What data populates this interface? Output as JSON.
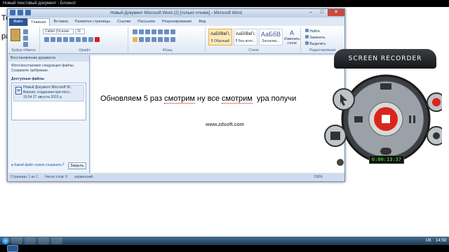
{
  "notepad": {
    "title": "Новый текстовый документ - Блокнот",
    "text_line1": "Те",
    "text_line2": "ра"
  },
  "word": {
    "title": "Новый Документ Microsoft Word (2) [только чтение] - Microsoft Word",
    "tabs": [
      "Файл",
      "Главная",
      "Вставка",
      "Разметка страницы",
      "Ссылки",
      "Рассылки",
      "Рецензирование",
      "Вид"
    ],
    "ribbon": {
      "clipboard_label": "Буфер обмена",
      "font_label": "Шрифт",
      "paragraph_label": "Абзац",
      "styles_label": "Стили",
      "editing_label": "Редактирование",
      "font_name": "Calibri (Основн",
      "font_size": "11",
      "styles": [
        {
          "sample": "АаБбВвГг,",
          "name": "¶ Обычный"
        },
        {
          "sample": "АаБбВвГг,",
          "name": "¶ Без инте..."
        },
        {
          "sample": "АаБбВ",
          "name": "Заголово..."
        }
      ],
      "change_styles": "Изменить стили",
      "find": "Найти",
      "replace": "Заменить",
      "select": "Выделить"
    },
    "recovery": {
      "header": "Восстановление документа",
      "message": "Word восстановил следующие файлы. Сохраните требуемые.",
      "available": "Доступные файлы",
      "item_title": "Новый Документ Microsoft W...",
      "item_line2": "Версия, созданная при посл...",
      "item_line3": "15:54 27 августа 2015 р.",
      "which_file": "Какой файл нужно сохранить?",
      "close": "Закрыть"
    },
    "document": {
      "text_parts": [
        "Обновляем 5 раз ",
        "смотрим",
        " ну все ",
        "смотрим",
        "  ура получи"
      ],
      "watermark": "www.zdsoft.com"
    },
    "status": {
      "page": "Страница: 1 из 1",
      "words": "Число слов: 9",
      "lang": "украинский",
      "zoom": "156%"
    }
  },
  "recorder": {
    "title": "SCREEN RECORDER",
    "timer": "0:00:13:37",
    "accent_red": "#d9261c"
  },
  "taskbar": {
    "lang": "UK",
    "time": "14:58"
  }
}
